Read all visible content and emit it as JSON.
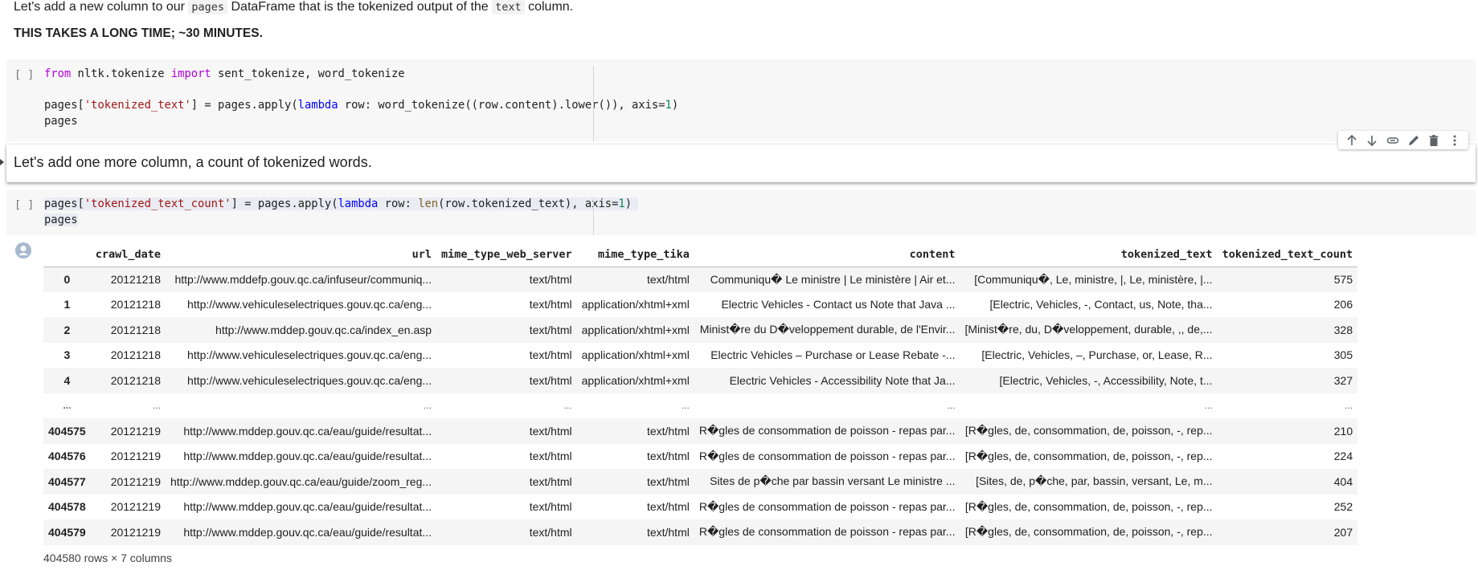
{
  "markdown": {
    "intro_prefix": "Let's add a new column to our ",
    "intro_code1": "pages",
    "intro_middle": " DataFrame that is the tokenized output of the ",
    "intro_code2": "text",
    "intro_suffix": " column.",
    "warning": "THIS TAKES A LONG TIME; ~30 MINUTES.",
    "selected_cell_text": "Let's add one more column, a count of tokenized words."
  },
  "cells": [
    {
      "run_label": "[ ]",
      "lines": {
        "l1_kw_from": "from",
        "l1_mid": " nltk.tokenize ",
        "l1_kw_import": "import",
        "l1_rest": " sent_tokenize, word_tokenize",
        "l3_a": "pages[",
        "l3_str": "'tokenized_text'",
        "l3_b": "] = pages.apply(",
        "l3_kw": "lambda",
        "l3_c": " row: word_tokenize((row.content).lower()), axis=",
        "l3_num": "1",
        "l3_d": ")",
        "l4": "pages"
      }
    },
    {
      "run_label": "[ ]",
      "lines": {
        "l1_a": "pages[",
        "l1_str": "'tokenized_text_count'",
        "l1_b": "] = pages.apply(",
        "l1_kw": "lambda",
        "l1_c": " row: ",
        "l1_fn": "len",
        "l1_d": "(row.tokenized_text), axis=",
        "l1_num": "1",
        "l1_e": ")",
        "l2": "pages"
      }
    }
  ],
  "toolbar": {
    "items": [
      {
        "icon": "arrow-up-icon",
        "label": "Move cell up"
      },
      {
        "icon": "arrow-down-icon",
        "label": "Move cell down"
      },
      {
        "icon": "link-icon",
        "label": "Copy link to cell"
      },
      {
        "icon": "pencil-icon",
        "label": "Edit"
      },
      {
        "icon": "trash-icon",
        "label": "Delete cell"
      },
      {
        "icon": "more-vert-icon",
        "label": "More actions"
      }
    ]
  },
  "output": {
    "icon": "user-avatar-icon",
    "dataframe": {
      "columns": [
        "",
        "crawl_date",
        "url",
        "mime_type_web_server",
        "mime_type_tika",
        "content",
        "tokenized_text",
        "tokenized_text_count"
      ],
      "rows": [
        [
          "0",
          "20121218",
          "http://www.mddefp.gouv.qc.ca/infuseur/communiq...",
          "text/html",
          "text/html",
          "Communiqu� Le ministre | Le ministère | Air et...",
          "[Communiqu�, Le, ministre, |, Le, ministère, |...",
          "575"
        ],
        [
          "1",
          "20121218",
          "http://www.vehiculeselectriques.gouv.qc.ca/eng...",
          "text/html",
          "application/xhtml+xml",
          "Electric Vehicles - Contact us Note that Java ...",
          "[Electric, Vehicles, -, Contact, us, Note, tha...",
          "206"
        ],
        [
          "2",
          "20121218",
          "http://www.mddep.gouv.qc.ca/index_en.asp",
          "text/html",
          "application/xhtml+xml",
          "Minist�re du D�veloppement durable, de l'Envir...",
          "[Minist�re, du, D�veloppement, durable, ,, de,...",
          "328"
        ],
        [
          "3",
          "20121218",
          "http://www.vehiculeselectriques.gouv.qc.ca/eng...",
          "text/html",
          "application/xhtml+xml",
          "Electric Vehicles – Purchase or Lease Rebate -...",
          "[Electric, Vehicles, –, Purchase, or, Lease, R...",
          "305"
        ],
        [
          "4",
          "20121218",
          "http://www.vehiculeselectriques.gouv.qc.ca/eng...",
          "text/html",
          "application/xhtml+xml",
          "Electric Vehicles - Accessibility Note that Ja...",
          "[Electric, Vehicles, -, Accessibility, Note, t...",
          "327"
        ],
        [
          "...",
          "...",
          "...",
          "...",
          "...",
          "...",
          "...",
          "..."
        ],
        [
          "404575",
          "20121219",
          "http://www.mddep.gouv.qc.ca/eau/guide/resultat...",
          "text/html",
          "text/html",
          "R�gles de consommation de poisson -  repas par...",
          "[R�gles, de, consommation, de, poisson, -, rep...",
          "210"
        ],
        [
          "404576",
          "20121219",
          "http://www.mddep.gouv.qc.ca/eau/guide/resultat...",
          "text/html",
          "text/html",
          "R�gles de consommation de poisson -  repas par...",
          "[R�gles, de, consommation, de, poisson, -, rep...",
          "224"
        ],
        [
          "404577",
          "20121219",
          "http://www.mddep.gouv.qc.ca/eau/guide/zoom_reg...",
          "text/html",
          "text/html",
          "Sites de p�che par bassin versant Le ministre ...",
          "[Sites, de, p�che, par, bassin, versant, Le, m...",
          "404"
        ],
        [
          "404578",
          "20121219",
          "http://www.mddep.gouv.qc.ca/eau/guide/resultat...",
          "text/html",
          "text/html",
          "R�gles de consommation de poisson -  repas par...",
          "[R�gles, de, consommation, de, poisson, -, rep...",
          "252"
        ],
        [
          "404579",
          "20121219",
          "http://www.mddep.gouv.qc.ca/eau/guide/resultat...",
          "text/html",
          "text/html",
          "R�gles de consommation de poisson -  repas par...",
          "[R�gles, de, consommation, de, poisson, -, rep...",
          "207"
        ]
      ],
      "footer": "404580 rows × 7 columns"
    }
  },
  "colors": {
    "keyword": "#af00db",
    "keyword_blue": "#0000ff",
    "string": "#a31515",
    "number": "#098658",
    "code_cell_bg": "#f7f7f7",
    "row_stripe": "#f5f5f5"
  }
}
